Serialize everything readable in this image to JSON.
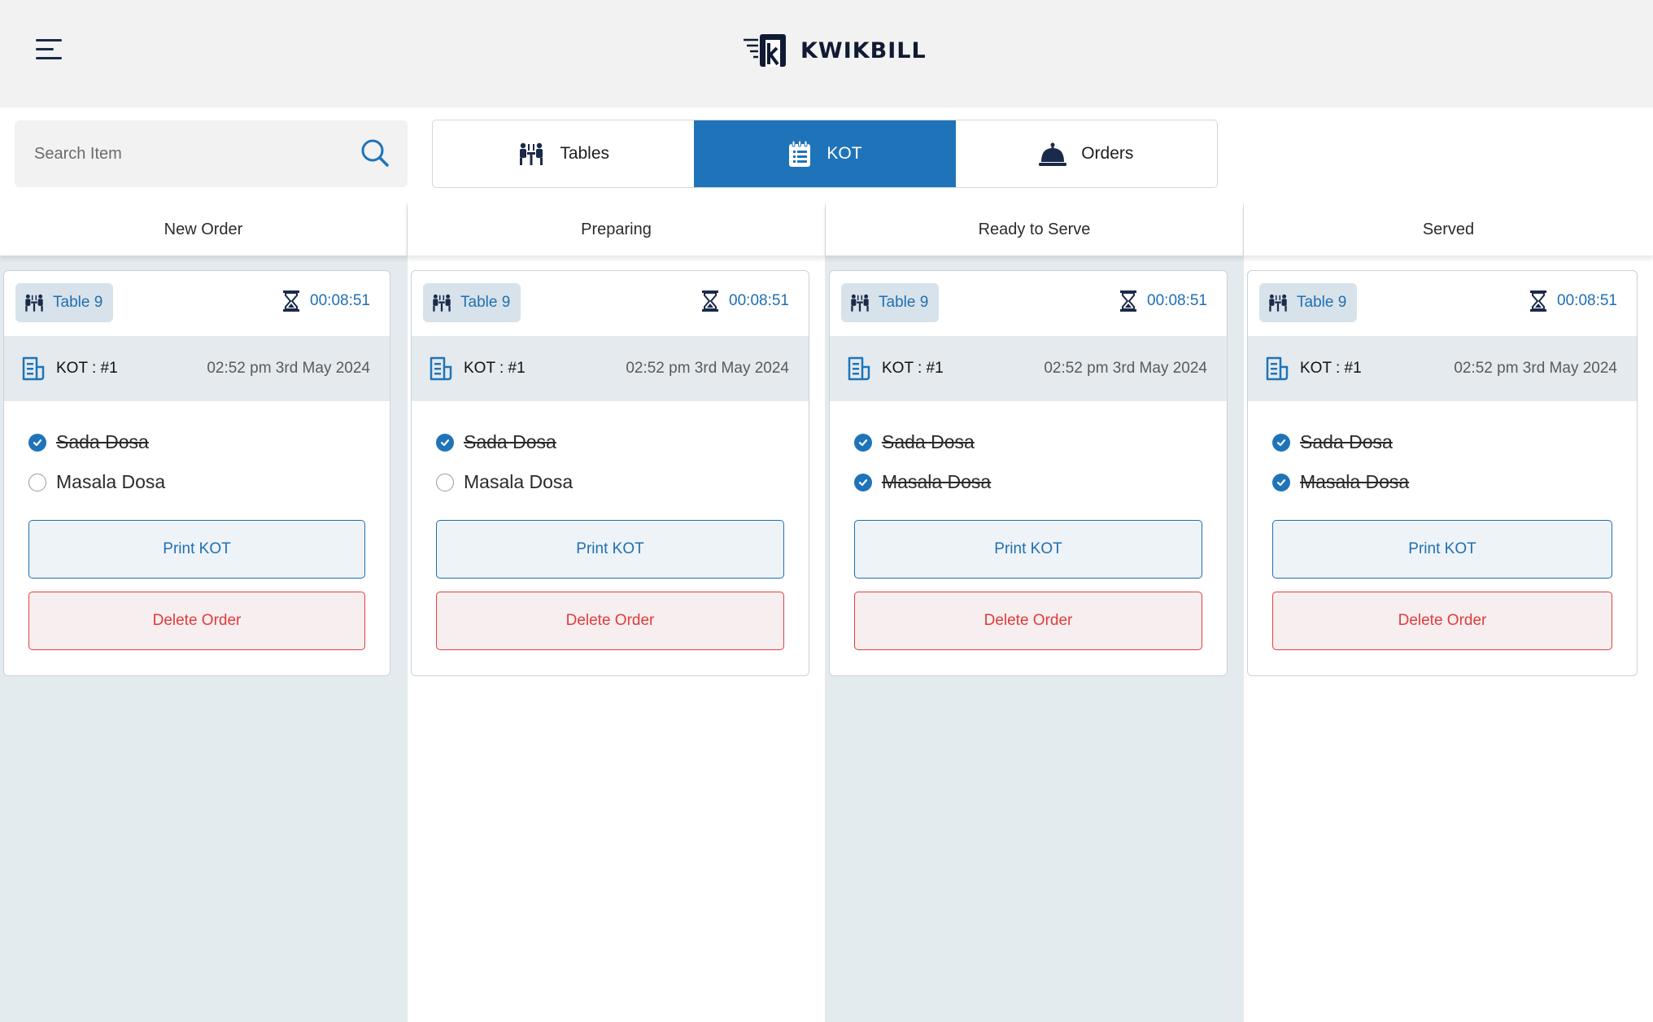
{
  "header": {
    "brand": "KWIKBILL",
    "menu_icon": "hamburger-menu-icon",
    "logo_icon": "kwikbill-logo-icon"
  },
  "search": {
    "placeholder": "Search Item",
    "value": ""
  },
  "tabs": [
    {
      "label": "Tables",
      "icon": "tables-icon",
      "active": false
    },
    {
      "label": "KOT",
      "icon": "kot-notepad-icon",
      "active": true
    },
    {
      "label": "Orders",
      "icon": "service-bell-icon",
      "active": false
    }
  ],
  "colors": {
    "accent": "#1f74b9",
    "danger": "#e03b3b",
    "shaded_column": "#e4ebef",
    "header_bg": "#f2f2f2"
  },
  "columns": [
    {
      "title": "New Order",
      "card": {
        "table": "Table 9",
        "timer": "00:08:51",
        "kot": "KOT : #1",
        "time": "02:52 pm 3rd May 2024",
        "items": [
          {
            "name": "Sada Dosa",
            "done": true
          },
          {
            "name": "Masala Dosa",
            "done": false
          }
        ],
        "print_label": "Print KOT",
        "delete_label": "Delete Order"
      }
    },
    {
      "title": "Preparing",
      "card": {
        "table": "Table 9",
        "timer": "00:08:51",
        "kot": "KOT : #1",
        "time": "02:52 pm 3rd May 2024",
        "items": [
          {
            "name": "Sada Dosa",
            "done": true
          },
          {
            "name": "Masala Dosa",
            "done": false
          }
        ],
        "print_label": "Print KOT",
        "delete_label": "Delete Order"
      }
    },
    {
      "title": "Ready to Serve",
      "card": {
        "table": "Table 9",
        "timer": "00:08:51",
        "kot": "KOT : #1",
        "time": "02:52 pm 3rd May 2024",
        "items": [
          {
            "name": "Sada Dosa",
            "done": true
          },
          {
            "name": "Masala Dosa",
            "done": true
          }
        ],
        "print_label": "Print KOT",
        "delete_label": "Delete Order"
      }
    },
    {
      "title": "Served",
      "card": {
        "table": "Table 9",
        "timer": "00:08:51",
        "kot": "KOT : #1",
        "time": "02:52 pm 3rd May 2024",
        "items": [
          {
            "name": "Sada Dosa",
            "done": true
          },
          {
            "name": "Masala Dosa",
            "done": true
          }
        ],
        "print_label": "Print KOT",
        "delete_label": "Delete Order"
      }
    }
  ]
}
